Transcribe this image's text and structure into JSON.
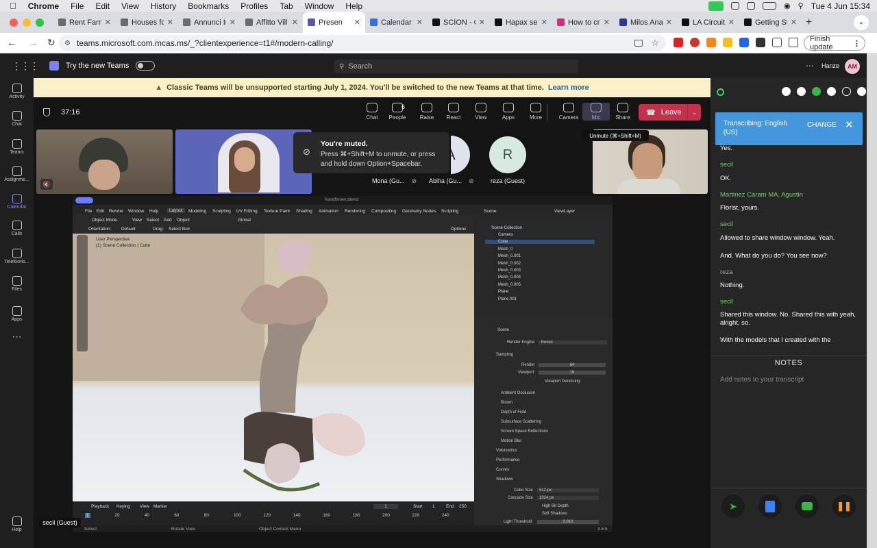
{
  "mac_menubar": {
    "app_name": "Chrome",
    "menus": [
      "File",
      "Edit",
      "View",
      "History",
      "Bookmarks",
      "Profiles",
      "Tab",
      "Window",
      "Help"
    ],
    "clock": "Tue 4 Jun  15:34"
  },
  "browser": {
    "tabs": [
      {
        "label": "Rent Farm",
        "fav_color": "#6b6b6b"
      },
      {
        "label": "Houses fo",
        "fav_color": "#6b6b6b"
      },
      {
        "label": "Annunci In",
        "fav_color": "#6b6b6b"
      },
      {
        "label": "Affitto Vill",
        "fav_color": "#6b6b6b"
      },
      {
        "label": "Presen",
        "fav_color": "#5558af",
        "active": true
      },
      {
        "label": "Calendar",
        "fav_color": "#3b6fd8"
      },
      {
        "label": "SCÌON - C",
        "fav_color": "#111"
      },
      {
        "label": "Hapax sec",
        "fav_color": "#111"
      },
      {
        "label": "How to cre",
        "fav_color": "#d62976"
      },
      {
        "label": "Milos Ana",
        "fav_color": "#2b3a8f"
      },
      {
        "label": "LA Circuit",
        "fav_color": "#111"
      },
      {
        "label": "Getting St",
        "fav_color": "#111"
      }
    ],
    "url": "teams.microsoft.com.mcas.ms/_?clientexperience=t1#/modern-calling/",
    "finish_update": "Finish update"
  },
  "teams_top": {
    "try_new": "Try the new Teams",
    "search_placeholder": "Search",
    "org": "Hanze",
    "avatar_initials": "AM"
  },
  "rail": [
    {
      "label": "Activity"
    },
    {
      "label": "Chat"
    },
    {
      "label": "Teams"
    },
    {
      "label": "Assignme..."
    },
    {
      "label": "Calendar",
      "active": true
    },
    {
      "label": "Calls"
    },
    {
      "label": "Telefoonb..."
    },
    {
      "label": "Files"
    },
    {
      "label": "Apps"
    },
    {
      "label": "Help"
    }
  ],
  "banner": {
    "text": "Classic Teams will be unsupported starting July 1, 2024. You'll be switched to the new Teams at that time.",
    "link": "Learn more"
  },
  "meeting": {
    "timer": "37:16",
    "controls": [
      {
        "label": "Chat"
      },
      {
        "label": "People",
        "count": "6"
      },
      {
        "label": "Raise"
      },
      {
        "label": "React"
      },
      {
        "label": "View"
      },
      {
        "label": "Apps"
      },
      {
        "label": "More"
      },
      {
        "label": "Camera"
      },
      {
        "label": "Mic",
        "active": true
      },
      {
        "label": "Share"
      }
    ],
    "leave": "Leave",
    "unmute_tooltip": "Unmute (⌘+Shift+M)",
    "muted_title": "You're muted.",
    "muted_body": "Press ⌘+Shift+M to unmute, or press and hold down Option+Spacebar.",
    "participants": [
      {
        "name": "Mona (Gu...",
        "initial": "",
        "kind": "avatar"
      },
      {
        "name": "Abiha (Gu...",
        "initial": "A",
        "kind": "avatar"
      },
      {
        "name": "reza (Guest)",
        "initial": "R",
        "kind": "avatar"
      }
    ],
    "presenter_label": "secil (Guest)"
  },
  "blender": {
    "title": "handflower.blend",
    "menus": [
      "File",
      "Edit",
      "Render",
      "Window",
      "Help"
    ],
    "workspaces": [
      "Layout",
      "Modeling",
      "Sculpting",
      "UV Editing",
      "Texture Paint",
      "Shading",
      "Animation",
      "Rendering",
      "Compositing",
      "Geometry Nodes",
      "Scripting"
    ],
    "scene": "Scene",
    "view_layer": "ViewLayer",
    "viewport_header": [
      "Object Mode",
      "View",
      "Select",
      "Add",
      "Object",
      "Global"
    ],
    "orientation_label": "Orientation:",
    "orientation_value": "Default",
    "drag_label": "Drag:",
    "drag_value": "Select Box",
    "options_label": "Options",
    "perspective": "User Perspective",
    "collection_info": "(1) Scene Collection | Cube",
    "outliner_root": "Scene Collection",
    "outliner_items": [
      "Camera",
      "Cube",
      "Mesh_0",
      "Mesh_0.001",
      "Mesh_0.002",
      "Mesh_0.003",
      "Mesh_0.004",
      "Mesh_0.005",
      "Plane",
      "Plane.001"
    ],
    "props_scene": "Scene",
    "render_engine_label": "Render Engine",
    "render_engine": "Eevee",
    "sampling": "Sampling",
    "render_label": "Render",
    "render_samples": "64",
    "viewport_label": "Viewport",
    "viewport_samples": "16",
    "viewport_denoising": "Viewport Denoising",
    "panels": [
      "Ambient Occlusion",
      "Bloom",
      "Depth of Field",
      "Subsurface Scattering",
      "Screen Space Reflections",
      "Motion Blur",
      "Volumetrics",
      "Performance",
      "Curves",
      "Shadows"
    ],
    "cube_size_label": "Cube Size",
    "cube_size": "512 px",
    "cascade_size_label": "Cascade Size",
    "cascade_size": "1024 px",
    "high_bit_depth": "High Bit Depth",
    "soft_shadows": "Soft Shadows",
    "light_threshold_label": "Light Threshold",
    "light_threshold": "0.010",
    "timeline_menus": [
      "Playback",
      "Keying",
      "View",
      "Marker"
    ],
    "current_frame": "1",
    "start_label": "Start",
    "start": "1",
    "end_label": "End",
    "end": "250",
    "frame_ticks": [
      "1",
      "20",
      "40",
      "60",
      "80",
      "100",
      "120",
      "140",
      "160",
      "180",
      "200",
      "220",
      "240"
    ],
    "status": [
      "Select",
      "Rotate View",
      "Object Context Menu"
    ],
    "version": "3.6.5"
  },
  "transcript": {
    "popup_text": "Transcribing: English (US)",
    "change": "CHANGE",
    "lines": [
      {
        "kind": "text",
        "text": "Yes."
      },
      {
        "kind": "speaker",
        "text": "secil"
      },
      {
        "kind": "text",
        "text": "OK."
      },
      {
        "kind": "speaker",
        "text": "Martinez Caram MA, Agustin"
      },
      {
        "kind": "text",
        "text": "Florist, yours."
      },
      {
        "kind": "speaker",
        "text": "secil"
      },
      {
        "kind": "text",
        "text": "Allowed to share window window. Yeah."
      },
      {
        "kind": "text",
        "text": "And. What do you do? You see now?"
      },
      {
        "kind": "speaker",
        "text": "reza"
      },
      {
        "kind": "text",
        "text": "Nothing."
      },
      {
        "kind": "speaker",
        "text": "secil"
      },
      {
        "kind": "text",
        "text": "Shared this window. No. Shared this with yeah, alright, so."
      },
      {
        "kind": "text",
        "text": "With the models that I created with the"
      }
    ],
    "notes_title": "NOTES",
    "notes_placeholder": "Add notes to your transcript"
  }
}
